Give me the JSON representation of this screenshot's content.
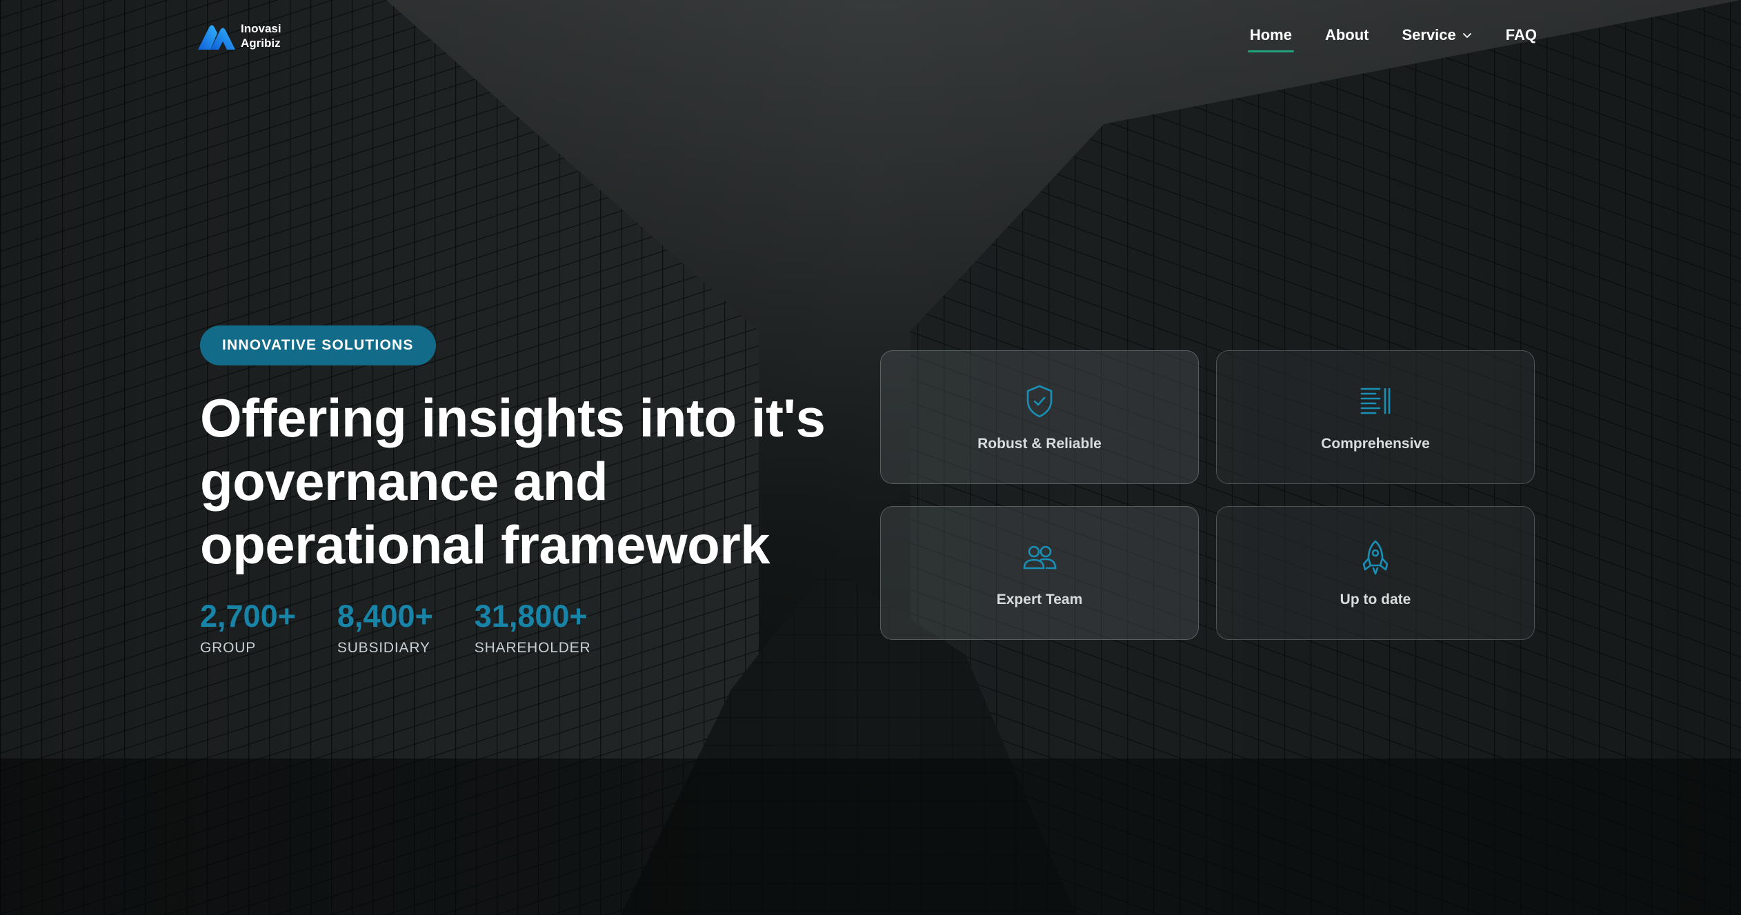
{
  "brand": {
    "line1": "Inovasi",
    "line2": "Agribiz",
    "logo_icon": "brand-logo"
  },
  "nav": {
    "items": [
      {
        "label": "Home",
        "active": true
      },
      {
        "label": "About",
        "active": false
      },
      {
        "label": "Service",
        "active": false,
        "has_dropdown": true,
        "icon": "chevron-down-icon"
      },
      {
        "label": "FAQ",
        "active": false
      }
    ]
  },
  "hero": {
    "badge": "INNOVATIVE SOLUTIONS",
    "headline": "Offering insights into it's governance and operational framework",
    "stats": [
      {
        "value": "2,700+",
        "label": "GROUP"
      },
      {
        "value": "8,400+",
        "label": "SUBSIDIARY"
      },
      {
        "value": "31,800+",
        "label": "SHAREHOLDER"
      }
    ]
  },
  "features": [
    {
      "label": "Robust & Reliable",
      "icon": "shield-check-icon"
    },
    {
      "label": "Comprehensive",
      "icon": "list-icon"
    },
    {
      "label": "Expert Team",
      "icon": "users-icon"
    },
    {
      "label": "Up to date",
      "icon": "rocket-icon"
    }
  ],
  "colors": {
    "accent": "#136b8a",
    "stat": "#1784a8",
    "nav_underline": "#1fa37a",
    "icon": "#1a8fb5"
  }
}
